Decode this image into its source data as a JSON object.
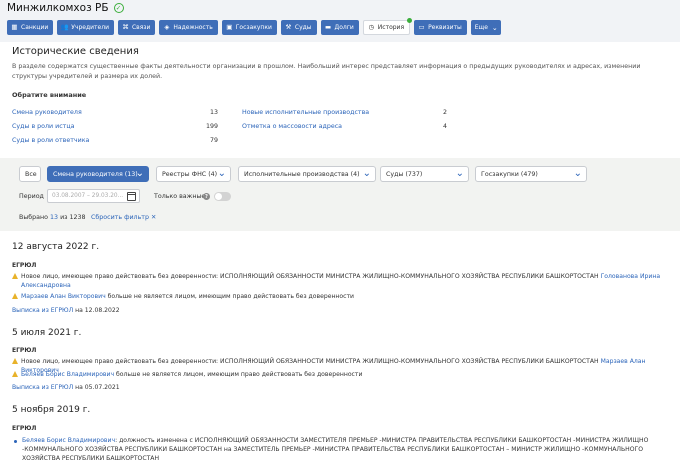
{
  "header": {
    "title": "Минжилкомхоз РБ",
    "tabs": [
      {
        "label": "Санкции",
        "icon": "building-icon"
      },
      {
        "label": "Учредители",
        "icon": "people-icon"
      },
      {
        "label": "Связи",
        "icon": "links-icon"
      },
      {
        "label": "Надежность",
        "icon": "shield-icon"
      },
      {
        "label": "Госзакупки",
        "icon": "case-icon"
      },
      {
        "label": "Суды",
        "icon": "hammer-icon"
      },
      {
        "label": "Долги",
        "icon": "money-icon"
      },
      {
        "label": "История",
        "icon": "clock-icon",
        "active": true
      },
      {
        "label": "Реквизиты",
        "icon": "card-icon"
      },
      {
        "label": "Еще",
        "icon": "chevron-down-icon"
      }
    ]
  },
  "page": {
    "heading": "Исторические сведения",
    "description": "В разделе содержатся существенные факты деятельности организации в прошлом. Наибольший интерес представляет информация о предыдущих руководителях и адресах, изменении структуры учредителей и размера их долей.",
    "attention_title": "Обратите внимание",
    "stats_left": [
      {
        "label": "Смена руководителя",
        "value": "13"
      },
      {
        "label": "Суды в роли истца",
        "value": "199"
      },
      {
        "label": "Суды в роли ответчика",
        "value": "79"
      }
    ],
    "stats_right": [
      {
        "label": "Новые исполнительные производства",
        "value": "2"
      },
      {
        "label": "Отметка о массовости адреса",
        "value": "4"
      }
    ]
  },
  "filters": {
    "buttons": [
      {
        "label": "Все"
      },
      {
        "label": "Смена руководителя (13)",
        "selected": true
      },
      {
        "label": "Реестры ФНС (4)"
      },
      {
        "label": "Исполнительные производства (4)"
      },
      {
        "label": "Суды (737)"
      },
      {
        "label": "Госзакупки (479)"
      }
    ],
    "period_label": "Период",
    "period_placeholder": "03.08.2007 – 29.03.20...",
    "important_label": "Только важные",
    "selected_prefix": "Выбрано",
    "selected_count": "13",
    "selected_of": "из 1238",
    "reset_label": "Сбросить фильтр"
  },
  "events": [
    {
      "date": "12 августа 2022 г.",
      "source": "ЕГРЮЛ",
      "line1_text": "Новое лицо, имеющее право действовать без доверенности: ИСПОЛНЯЮЩИЙ ОБЯЗАННОСТИ МИНИСТРА ЖИЛИЩНО-КОММУНАЛЬНОГО ХОЗЯЙСТВА РЕСПУБЛИКИ БАШКОРТОСТАН ",
      "line1_person": "Голованова Ирина Александровна",
      "line2_person": "Марзаев Алан Викторович",
      "line2_text": " больше не является лицом, имеющим право действовать без доверенности",
      "extract_link": "Выписка из ЕГРЮЛ",
      "extract_date": " на 12.08.2022"
    },
    {
      "date": "5 июля 2021 г.",
      "source": "ЕГРЮЛ",
      "line1_text": "Новое лицо, имеющее право действовать без доверенности: ИСПОЛНЯЮЩИЙ ОБЯЗАННОСТИ МИНИСТРА ЖИЛИЩНО-КОММУНАЛЬНОГО ХОЗЯЙСТВА РЕСПУБЛИКИ БАШКОРТОСТАН ",
      "line1_person": "Марзаев Алан Викторович",
      "line2_person": "Беляев Борис Владимирович",
      "line2_text": " больше не является лицом, имеющим право действовать без доверенности",
      "extract_link": "Выписка из ЕГРЮЛ",
      "extract_date": " на 05.07.2021"
    },
    {
      "date": "5 ноября 2019 г.",
      "source": "ЕГРЮЛ",
      "line1_person": "Беляев Борис Владимирович",
      "line1_text": ": должность изменена с ИСПОЛНЯЮЩИЙ ОБЯЗАННОСТИ ЗАМЕСТИТЕЛЯ ПРЕМЬЕР -МИНИСТРА ПРАВИТЕЛЬСТВА РЕСПУБЛИКИ БАШКОРТОСТАН -МИНИСТРА ЖИЛИЩНО -КОММУНАЛЬНОГО ХОЗЯЙСТВА РЕСПУБЛИКИ БАШКОРТОСТАН на ЗАМЕСТИТЕЛЬ ПРЕМЬЕР -МИНИСТРА ПРАВИТЕЛЬСТВА РЕСПУБЛИКИ БАШКОРТОСТАН – МИНИСТР ЖИЛИЩНО -КОММУНАЛЬНОГО ХОЗЯЙСТВА РЕСПУБЛИКИ БАШКОРТОСТАН"
    }
  ],
  "colors": {
    "accent": "#3f6eb8",
    "link": "#2b64b9",
    "verified": "#3bae3b",
    "warning": "#e8b22a"
  }
}
